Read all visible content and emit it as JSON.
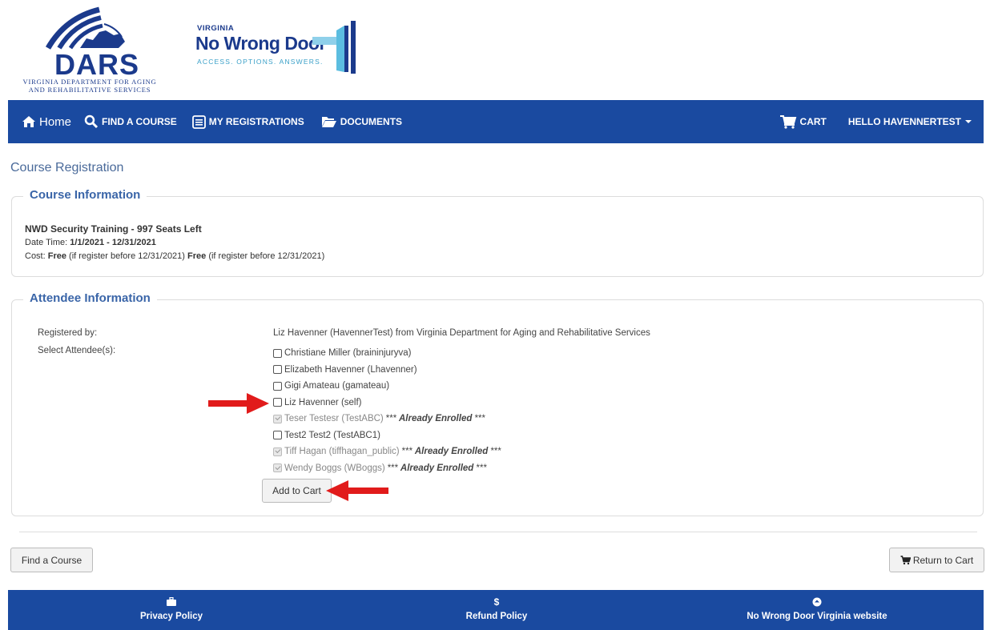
{
  "header": {
    "dars": {
      "name": "DARS",
      "sub1": "Virginia Department for Aging",
      "sub2": "and Rehabilitative Services"
    },
    "nwd": {
      "state": "VIRGINIA",
      "name": "No Wrong Door",
      "tagline": "ACCESS. OPTIONS. ANSWERS."
    }
  },
  "nav": {
    "home": "Home",
    "find_course": "FIND A COURSE",
    "my_registrations": "MY REGISTRATIONS",
    "documents": "DOCUMENTS",
    "cart": "CART",
    "user": "HELLO HAVENNERTEST"
  },
  "page": {
    "title": "Course Registration"
  },
  "course": {
    "legend": "Course Information",
    "name": "NWD Security Training - 997 Seats Left",
    "date_label": "Date Time: ",
    "date_value": "1/1/2021 - 12/31/2021",
    "cost_label": "Cost: ",
    "cost_free_1": "Free",
    "cost_note_1": " (if register before 12/31/2021) ",
    "cost_free_2": "Free",
    "cost_note_2": " (if register before 12/31/2021)"
  },
  "attendee": {
    "legend": "Attendee Information",
    "registered_by_label": "Registered by:",
    "registered_by_value": "Liz Havenner (HavennerTest) from Virginia Department for Aging and Rehabilitative Services",
    "select_label": "Select Attendee(s):",
    "enrolled_stars": "***",
    "enrolled_text": "Already Enrolled",
    "list": [
      {
        "name": "Christiane Miller (braininjuryva)",
        "enrolled": false
      },
      {
        "name": "Elizabeth Havenner (Lhavenner)",
        "enrolled": false
      },
      {
        "name": "Gigi Amateau (gamateau)",
        "enrolled": false
      },
      {
        "name": "Liz Havenner (self)",
        "enrolled": false
      },
      {
        "name": "Teser Testesr (TestABC)",
        "enrolled": true
      },
      {
        "name": "Test2 Test2 (TestABC1)",
        "enrolled": false
      },
      {
        "name": "Tiff Hagan (tiffhagan_public)",
        "enrolled": true
      },
      {
        "name": "Wendy Boggs (WBoggs)",
        "enrolled": true
      }
    ],
    "add_to_cart": "Add to Cart"
  },
  "actions": {
    "find_course": "Find a Course",
    "return_to_cart": "Return to Cart"
  },
  "footer": {
    "privacy": "Privacy Policy",
    "refund_icon": "$",
    "refund": "Refund Policy",
    "nwd_site": "No Wrong Door Virginia website"
  },
  "colors": {
    "nav_bg": "#1a4aa0",
    "legend": "#3a65a8",
    "arrow": "#e11b1b"
  }
}
